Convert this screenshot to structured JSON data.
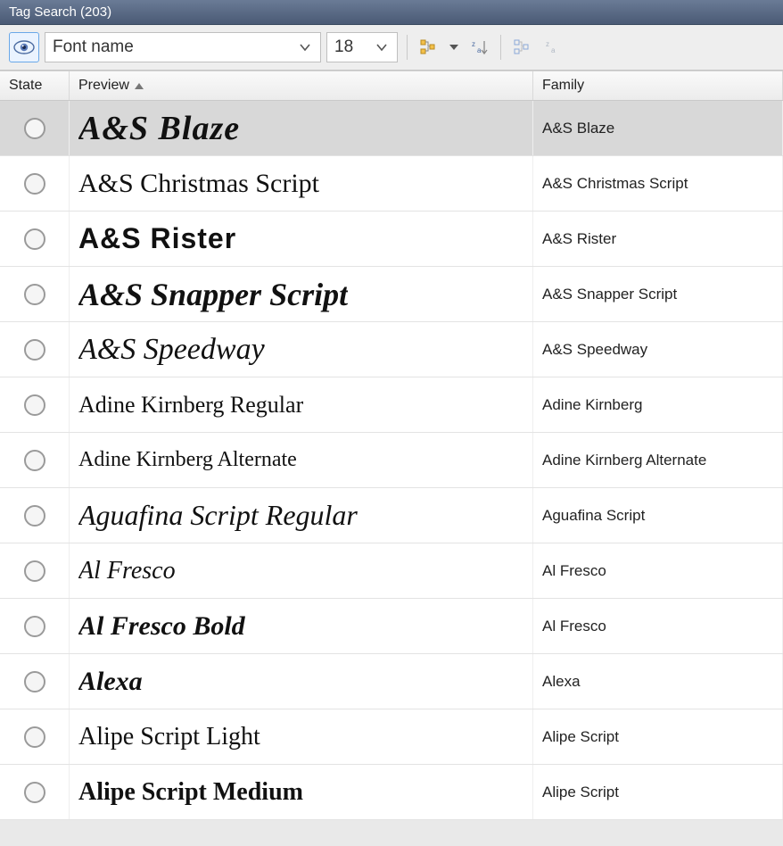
{
  "titlebar": {
    "text": "Tag Search (203)"
  },
  "toolbar": {
    "font_name_value": "Font name",
    "size_value": "18"
  },
  "columns": {
    "state": "State",
    "preview": "Preview",
    "family": "Family"
  },
  "rows": [
    {
      "preview": "A&S Blaze",
      "family": "A&S Blaze",
      "style": "font-family:'Brush Script MT','Segoe Script',cursive;font-weight:900;font-style:italic;font-size:38px;letter-spacing:1px;",
      "selected": true
    },
    {
      "preview": "A&S Christmas Script",
      "family": "A&S Christmas Script",
      "style": "font-family:'Segoe Script','Lucida Handwriting',cursive;font-size:30px;"
    },
    {
      "preview": "A&S Rister",
      "family": "A&S Rister",
      "style": "font-family:Impact,'Arial Black',sans-serif;font-weight:900;font-size:32px;letter-spacing:1px;"
    },
    {
      "preview": "A&S Snapper Script",
      "family": "A&S Snapper Script",
      "style": "font-family:'Brush Script MT',cursive;font-style:italic;font-weight:700;font-size:36px;"
    },
    {
      "preview": "A&S Speedway",
      "family": "A&S Speedway",
      "style": "font-family:'Brush Script MT',cursive;font-style:italic;font-size:34px;"
    },
    {
      "preview": "Adine Kirnberg Regular",
      "family": "Adine Kirnberg",
      "style": "font-family:'Edwardian Script ITC','Segoe Script',cursive;font-size:26px;"
    },
    {
      "preview": "Adine Kirnberg Alternate",
      "family": "Adine Kirnberg Alternate",
      "style": "font-family:'Edwardian Script ITC','Segoe Script',cursive;font-size:24px;"
    },
    {
      "preview": "Aguafina Script Regular",
      "family": "Aguafina Script",
      "style": "font-family:'Segoe Script','Brush Script MT',cursive;font-style:italic;font-size:32px;"
    },
    {
      "preview": "Al Fresco",
      "family": "Al Fresco",
      "style": "font-family:'Edwardian Script ITC','Segoe Script',cursive;font-style:italic;font-size:28px;"
    },
    {
      "preview": "Al Fresco Bold",
      "family": "Al Fresco",
      "style": "font-family:'Edwardian Script ITC','Segoe Script',cursive;font-style:italic;font-weight:700;font-size:30px;"
    },
    {
      "preview": "Alexa",
      "family": "Alexa",
      "style": "font-family:'Lucida Handwriting','Segoe Script',cursive;font-style:italic;font-weight:600;font-size:30px;"
    },
    {
      "preview": "Alipe Script Light",
      "family": "Alipe Script",
      "style": "font-family:'Edwardian Script ITC','Segoe Script',cursive;font-size:28px;"
    },
    {
      "preview": "Alipe Script Medium",
      "family": "Alipe Script",
      "style": "font-family:'Edwardian Script ITC','Segoe Script',cursive;font-weight:600;font-size:28px;"
    }
  ]
}
